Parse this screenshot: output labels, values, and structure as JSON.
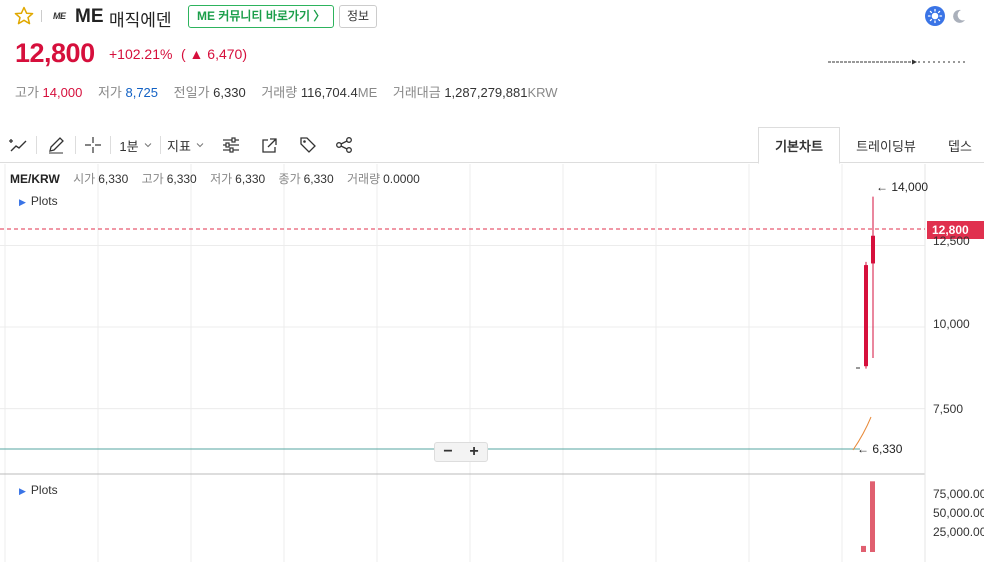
{
  "header": {
    "logo_text": "ME",
    "symbol": "ME",
    "name": "매직에덴",
    "community_button": "ME 커뮤니티 바로가기 〉",
    "info_button": "정보"
  },
  "ticker": {
    "price": "12,800",
    "change_rate": "+102.21%",
    "change_amount": "( ▲ 6,470)"
  },
  "stats": {
    "high_label": "고가",
    "high": "14,000",
    "low_label": "저가",
    "low": "8,725",
    "prev_label": "전일가",
    "prev": "6,330",
    "volume_label": "거래량",
    "volume": "116,704.4",
    "volume_unit": "ME",
    "amount_label": "거래대금",
    "amount": "1,287,279,881",
    "amount_unit": "KRW"
  },
  "toolbar": {
    "interval": "1분",
    "indicator": "지표",
    "tabs": [
      "기본차트",
      "트레이딩뷰",
      "뎁스"
    ]
  },
  "legend": {
    "pair": "ME/KRW",
    "open_label": "시가",
    "open": "6,330",
    "high_label": "고가",
    "high": "6,330",
    "low_label": "저가",
    "low": "6,330",
    "close_label": "종가",
    "close": "6,330",
    "vol_label": "거래량",
    "vol": "0.0000",
    "plots": "Plots",
    "plots2": "Plots"
  },
  "price_axis": {
    "last_price_tag": "12,800",
    "labels": [
      "12,500",
      "10,000",
      "7,500"
    ],
    "annotation_high": "← 14,000",
    "annotation_prev": "← 6,330"
  },
  "volume_axis": {
    "labels": [
      "75,000.00",
      "50,000.00",
      "25,000.00"
    ]
  },
  "colors": {
    "up": "#d60f3c",
    "accent_green": "#2db35d",
    "blue": "#1261c4",
    "grid": "#ececec"
  },
  "chart_data": {
    "type": "candlestick",
    "pair": "ME/KRW",
    "price_ylim": [
      5800,
      15000
    ],
    "last_price": 12800,
    "previous_close": 6330,
    "candles": [
      {
        "open": 8800,
        "high": 12000,
        "low": 8725,
        "close": 11900
      },
      {
        "open": 11950,
        "high": 14000,
        "low": 9050,
        "close": 12800
      }
    ],
    "volume": [
      8000,
      93000
    ]
  }
}
